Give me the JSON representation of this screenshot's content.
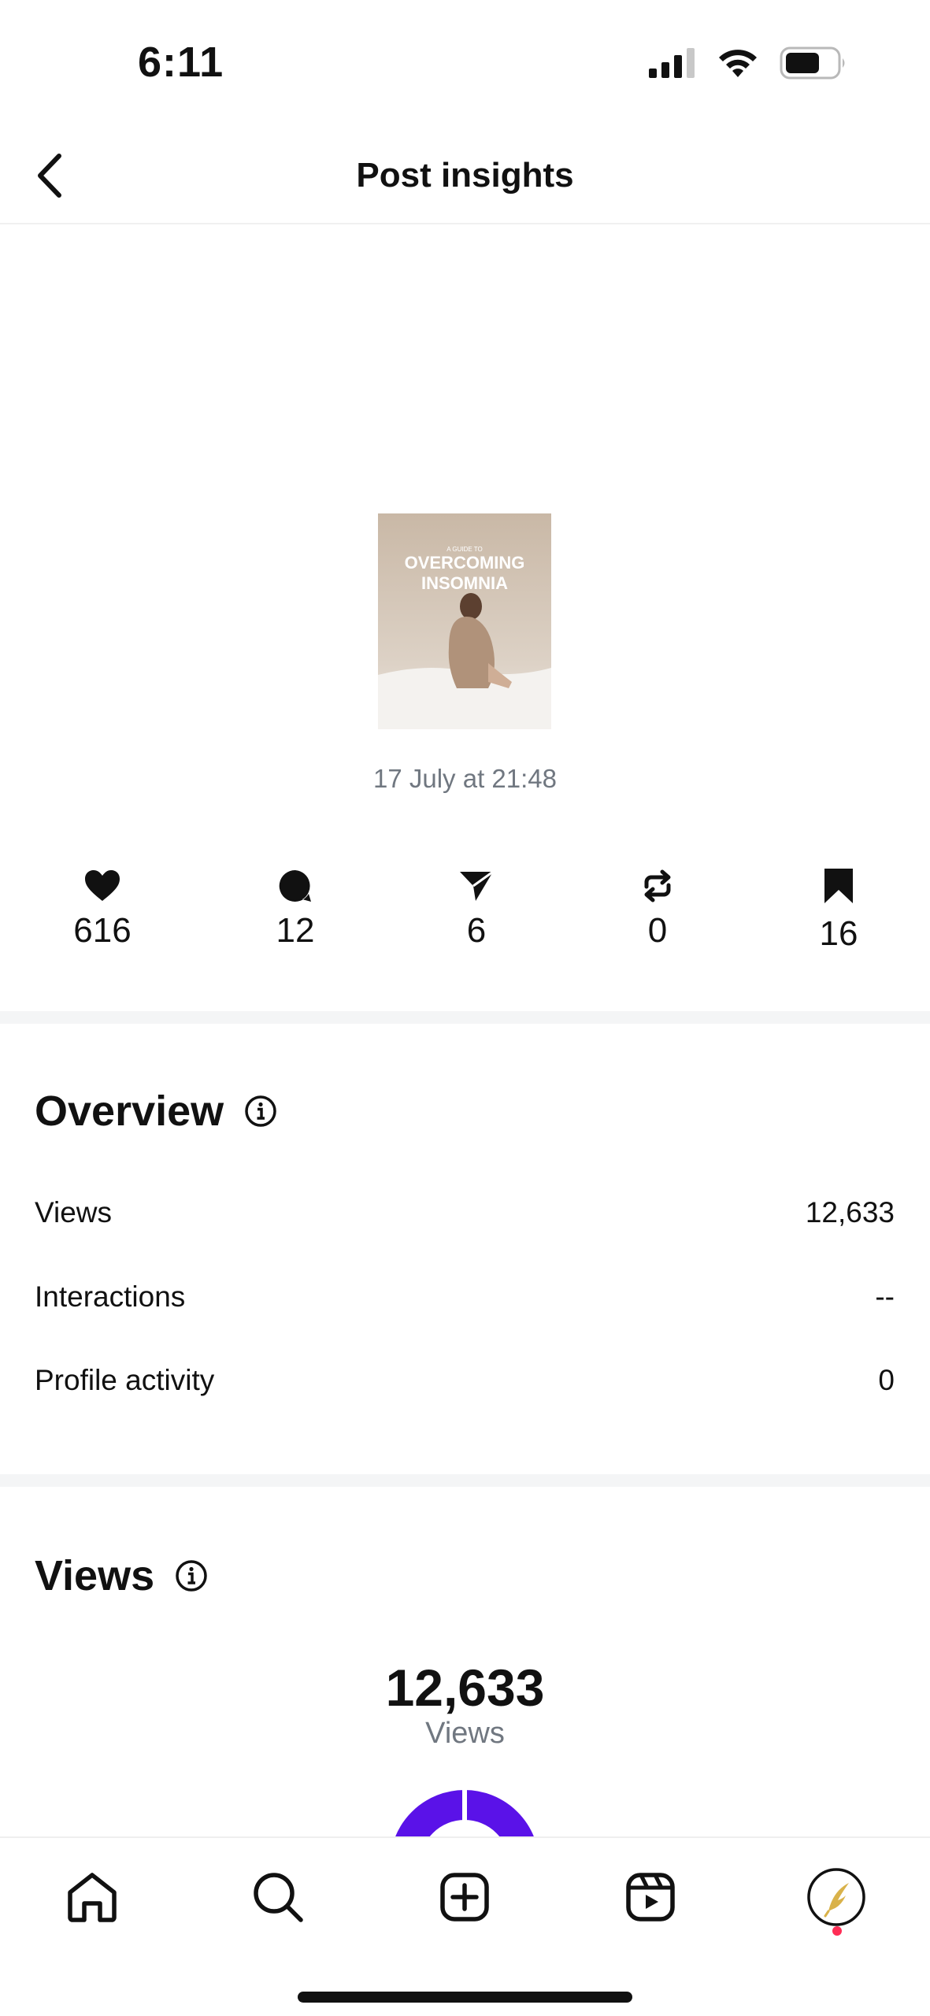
{
  "status_bar": {
    "time": "6:11"
  },
  "header": {
    "title": "Post insights"
  },
  "post": {
    "cover_small": "A GUIDE TO",
    "cover_title_1": "OVERCOMING",
    "cover_title_2": "INSOMNIA",
    "date": "17 July at 21:48"
  },
  "stats": {
    "likes": "616",
    "comments": "12",
    "shares": "6",
    "reposts": "0",
    "saves": "16"
  },
  "overview": {
    "heading": "Overview",
    "rows": [
      {
        "label": "Views",
        "value": "12,633"
      },
      {
        "label": "Interactions",
        "value": "--"
      },
      {
        "label": "Profile activity",
        "value": "0"
      }
    ]
  },
  "views": {
    "heading": "Views",
    "total": "12,633",
    "caption": "Views"
  },
  "colors": {
    "accent": "#5a12e8",
    "muted_text": "#707780",
    "notification": "#ff2d55"
  },
  "icons": {
    "back": "chevron-left-icon",
    "like": "heart-icon",
    "comment": "comment-icon",
    "share": "send-icon",
    "repost": "repost-icon",
    "save": "bookmark-icon",
    "info": "info-icon",
    "nav": [
      "home-icon",
      "search-icon",
      "create-icon",
      "reels-icon",
      "profile-avatar-icon"
    ]
  }
}
